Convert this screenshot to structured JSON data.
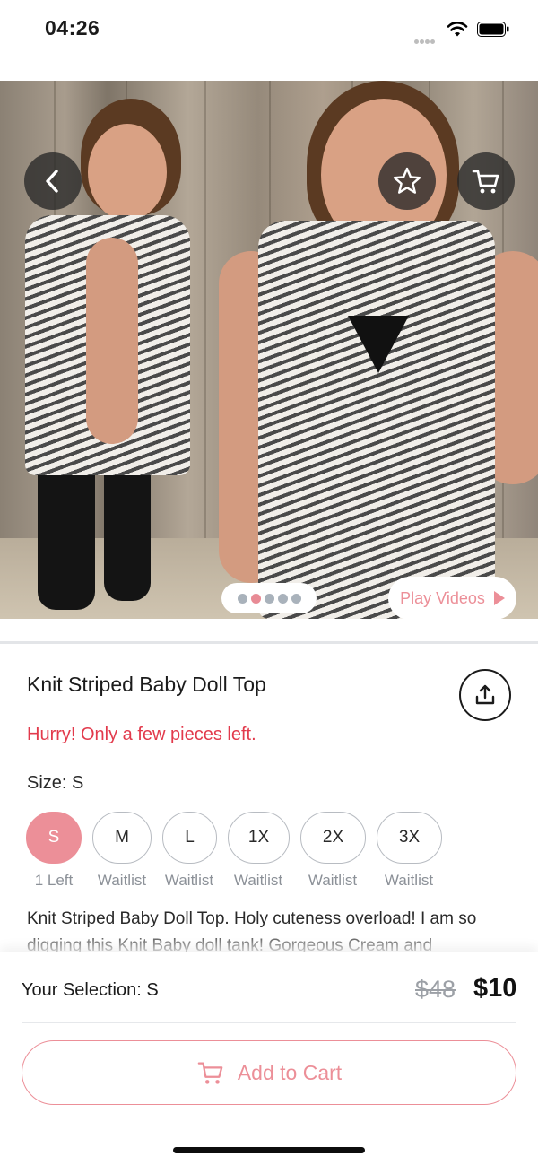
{
  "status_bar": {
    "time": "04:26"
  },
  "product": {
    "title": "Knit Striped Baby Doll Top",
    "stock_message": "Hurry! Only a few pieces left.",
    "size_label": "Size: S",
    "sizes": [
      {
        "label": "S",
        "status": "1 Left",
        "selected": true
      },
      {
        "label": "M",
        "status": "Waitlist",
        "selected": false
      },
      {
        "label": "L",
        "status": "Waitlist",
        "selected": false
      },
      {
        "label": "1X",
        "status": "Waitlist",
        "selected": false
      },
      {
        "label": "2X",
        "status": "Waitlist",
        "selected": false
      },
      {
        "label": "3X",
        "status": "Waitlist",
        "selected": false
      }
    ],
    "description": "Knit Striped Baby Doll Top. Holy cuteness overload! I am so digging this Knit Baby doll tank!  Gorgeous Cream and"
  },
  "gallery": {
    "image_count": 5,
    "active_index": 1,
    "play_videos_label": "Play Videos"
  },
  "checkout": {
    "selection": "Your Selection: S",
    "original_price": "$48",
    "sale_price": "$10",
    "add_to_cart_label": "Add to Cart"
  },
  "icons": {
    "back": "chevron-left-icon",
    "favorite": "star-icon",
    "cart": "cart-icon",
    "share": "share-icon",
    "play": "play-icon"
  },
  "colors": {
    "accent": "#ec8f98",
    "alert": "#e23a4c",
    "overlay": "#282828"
  }
}
